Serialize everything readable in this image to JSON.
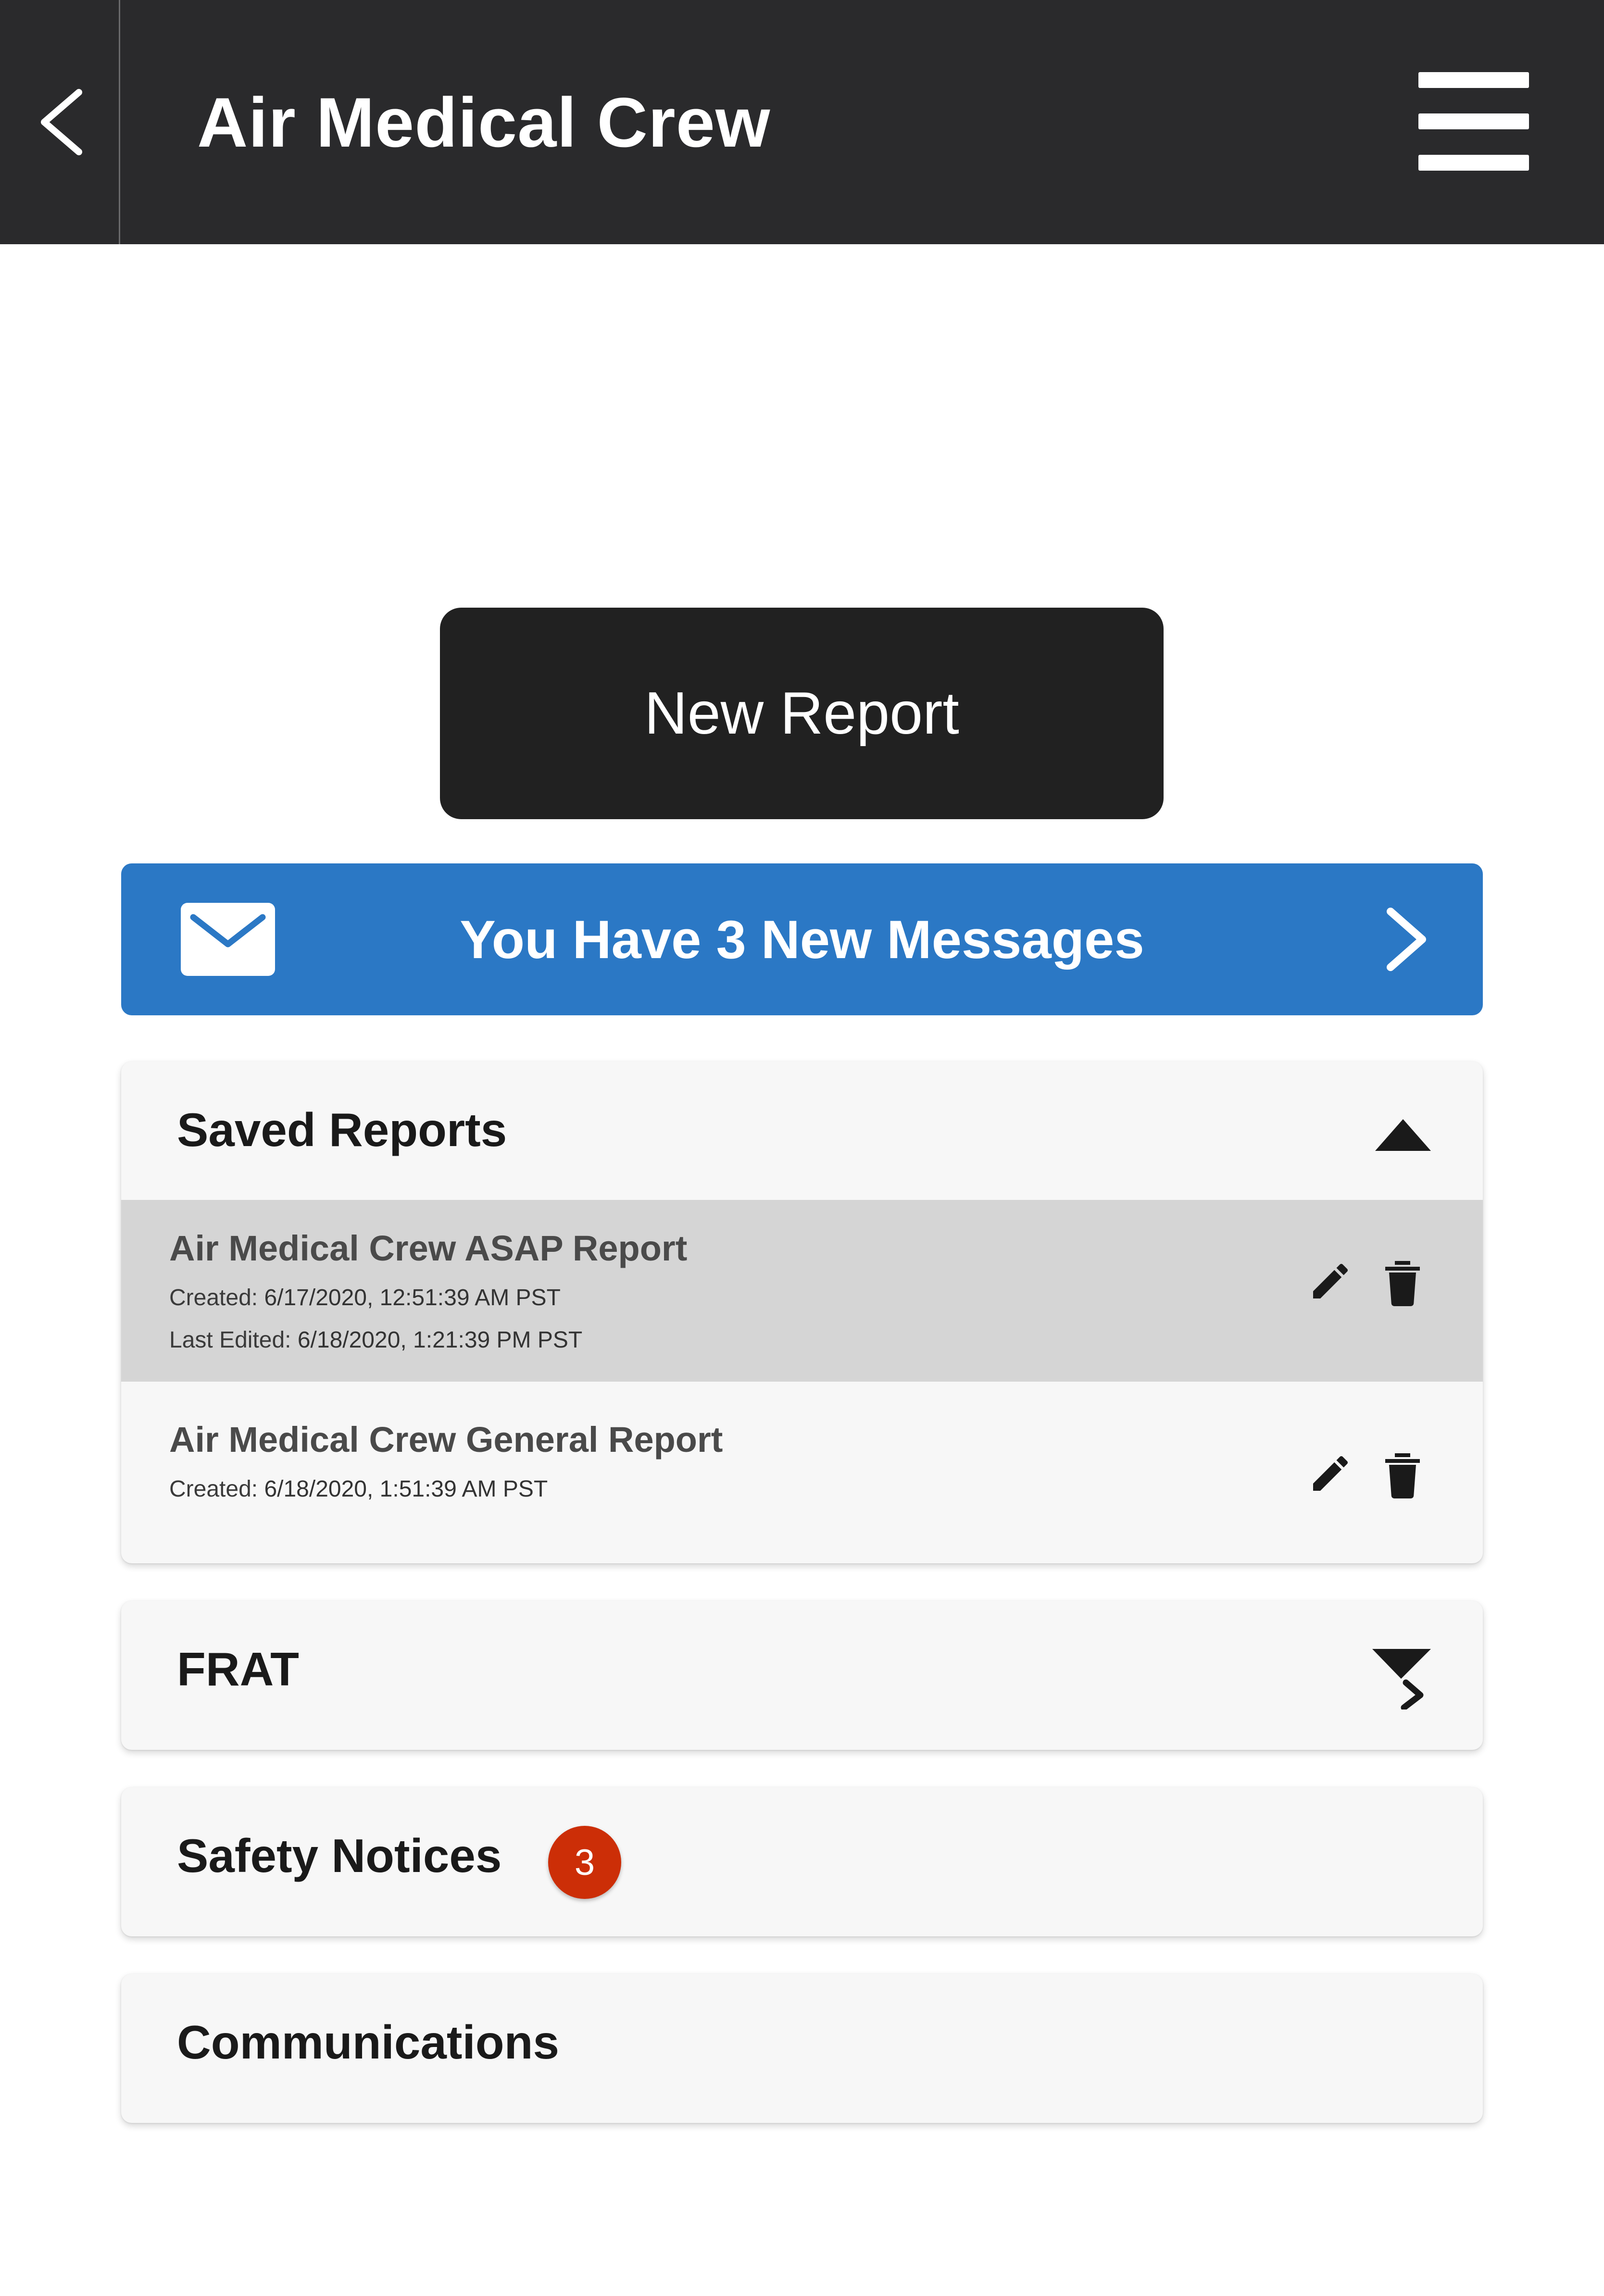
{
  "header": {
    "title": "Air Medical Crew",
    "background": "#2a2a2c",
    "back_icon": "chevron-left-icon",
    "menu_icon": "hamburger-menu-icon"
  },
  "new_report": {
    "label": "New Report"
  },
  "messages": {
    "label": "You Have 3 New Messages",
    "icon": "envelope-icon",
    "chevron_icon": "chevron-right-icon",
    "background": "#2b78c5"
  },
  "saved_reports": {
    "title": "Saved Reports",
    "toggle_icon": "caret-up-icon",
    "items": [
      {
        "name": "Air Medical Crew ASAP Report",
        "created_label": "Created:",
        "created": "6/17/2020, 12:51:39 AM PST",
        "edited_label": "Last Edited:",
        "edited": "6/18/2020, 1:21:39 PM PST",
        "edit_icon": "pencil-icon",
        "delete_icon": "trash-icon"
      },
      {
        "name": "Air Medical Crew General Report",
        "created_label": "Created:",
        "created": "6/18/2020, 1:51:39 AM PST",
        "edit_icon": "pencil-icon",
        "delete_icon": "trash-icon"
      }
    ]
  },
  "frat": {
    "title": "FRAT",
    "icon": "filter-expand-icon"
  },
  "safety_notices": {
    "title": "Safety Notices",
    "badge": "3",
    "badge_color": "#cc2e07"
  },
  "communications": {
    "title": "Communications"
  }
}
